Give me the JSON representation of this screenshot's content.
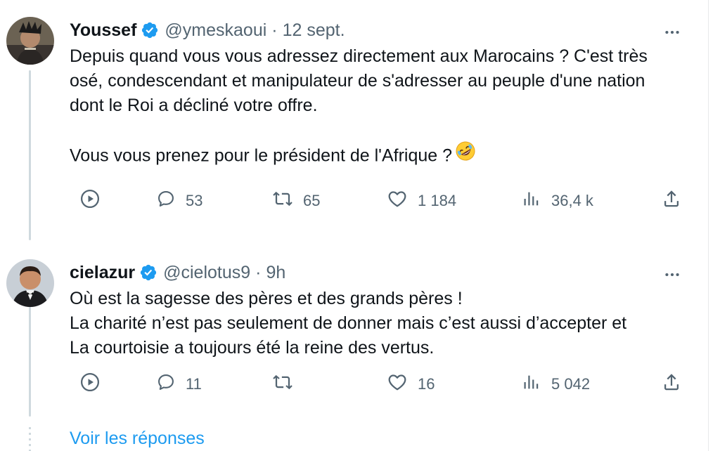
{
  "tweets": [
    {
      "display_name": "Youssef",
      "handle": "@ymeskaoui",
      "separator": "·",
      "timestamp": "12 sept.",
      "text_lines": [
        "Depuis quand vous vous adressez directement aux Marocains ? C'est très",
        "osé, condescendant et manipulateur de s'adresser au peuple d'une nation",
        "dont le Roi a décliné votre offre."
      ],
      "text_line_after_gap": "Vous vous prenez pour le président de l'Afrique ?",
      "emoji": "rolling-on-the-floor-laughing",
      "replies": "53",
      "retweets": "65",
      "likes": "1 184",
      "views": "36,4 k"
    },
    {
      "display_name": "cielazur",
      "handle": "@cielotus9",
      "separator": "·",
      "timestamp": "9h",
      "text_lines": [
        "Où est la sagesse des pères et des grands pères !",
        "La charité n’est pas seulement de donner mais c’est aussi d’accepter et",
        "La courtoisie a toujours été la reine des vertus."
      ],
      "replies": "11",
      "retweets": "",
      "likes": "16",
      "views": "5 042"
    }
  ],
  "show_replies_label": "Voir les réponses",
  "icons": {
    "verified": "verified-badge-icon",
    "more": "more-horizontal-icon",
    "play": "play-icon",
    "reply": "reply-icon",
    "retweet": "retweet-icon",
    "like": "heart-icon",
    "views": "views-icon",
    "share": "share-icon"
  },
  "colors": {
    "accent": "#1d9bf0",
    "text_primary": "#0f1419",
    "text_secondary": "#536471",
    "thread_line": "#cfd9de"
  }
}
